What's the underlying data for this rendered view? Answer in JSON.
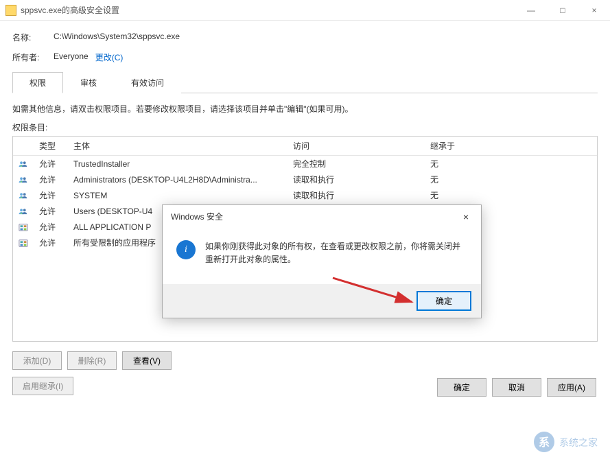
{
  "window": {
    "title": "sppsvc.exe的高级安全设置",
    "minimize": "—",
    "maximize": "□",
    "close": "×"
  },
  "fields": {
    "name_label": "名称:",
    "name_value": "C:\\Windows\\System32\\sppsvc.exe",
    "owner_label": "所有者:",
    "owner_value": "Everyone",
    "change_link": "更改(C)"
  },
  "tabs": {
    "permissions": "权限",
    "audit": "审核",
    "effective": "有效访问"
  },
  "help_text": "如需其他信息，请双击权限项目。若要修改权限项目，请选择该项目并单击\"编辑\"(如果可用)。",
  "entries_label": "权限条目:",
  "columns": {
    "type": "类型",
    "principal": "主体",
    "access": "访问",
    "inherit": "继承于"
  },
  "rows": [
    {
      "icon": "users",
      "type": "允许",
      "principal": "TrustedInstaller",
      "access": "完全控制",
      "inherit": "无"
    },
    {
      "icon": "users",
      "type": "允许",
      "principal": "Administrators (DESKTOP-U4L2H8D\\Administra...",
      "access": "读取和执行",
      "inherit": "无"
    },
    {
      "icon": "users",
      "type": "允许",
      "principal": "SYSTEM",
      "access": "读取和执行",
      "inherit": "无"
    },
    {
      "icon": "users",
      "type": "允许",
      "principal": "Users (DESKTOP-U4",
      "access": "",
      "inherit": ""
    },
    {
      "icon": "pkg",
      "type": "允许",
      "principal": "ALL APPLICATION P",
      "access": "",
      "inherit": ""
    },
    {
      "icon": "pkg",
      "type": "允许",
      "principal": "所有受限制的应用程序",
      "access": "",
      "inherit": ""
    }
  ],
  "buttons": {
    "add": "添加(D)",
    "remove": "删除(R)",
    "view": "查看(V)",
    "enable_inherit": "启用继承(I)",
    "ok": "确定",
    "cancel": "取消",
    "apply": "应用(A)"
  },
  "dialog": {
    "title": "Windows 安全",
    "message": "如果你刚获得此对象的所有权，在查看或更改权限之前，你将需关闭并重新打开此对象的属性。",
    "ok": "确定",
    "close": "×"
  }
}
